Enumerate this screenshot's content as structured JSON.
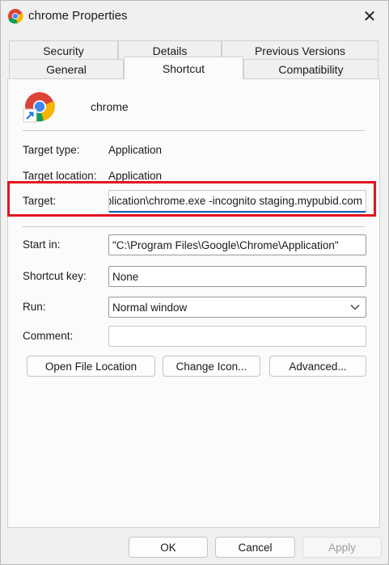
{
  "window": {
    "title": "chrome Properties",
    "close_glyph": "✕"
  },
  "tabs": {
    "row1": [
      "Security",
      "Details",
      "Previous Versions"
    ],
    "row2": [
      "General",
      "Shortcut",
      "Compatibility"
    ],
    "active": "Shortcut"
  },
  "app": {
    "name": "chrome",
    "icon": "chrome-shortcut-icon"
  },
  "fields": {
    "target_type": {
      "label": "Target type:",
      "value": "Application"
    },
    "target_location": {
      "label": "Target location:",
      "value": "Application"
    },
    "target": {
      "label": "Target:",
      "value": "plication\\chrome.exe -incognito staging.mypubid.com"
    },
    "start_in": {
      "label": "Start in:",
      "value": "\"C:\\Program Files\\Google\\Chrome\\Application\""
    },
    "shortcut_key": {
      "label": "Shortcut key:",
      "value": "None"
    },
    "run": {
      "label": "Run:",
      "value": "Normal window"
    },
    "comment": {
      "label": "Comment:",
      "value": ""
    }
  },
  "buttons": {
    "open_file_location": "Open File Location",
    "change_icon": "Change Icon...",
    "advanced": "Advanced...",
    "ok": "OK",
    "cancel": "Cancel",
    "apply": "Apply"
  },
  "colors": {
    "highlight": "#e2141d",
    "focus_underline": "#005fb8"
  }
}
